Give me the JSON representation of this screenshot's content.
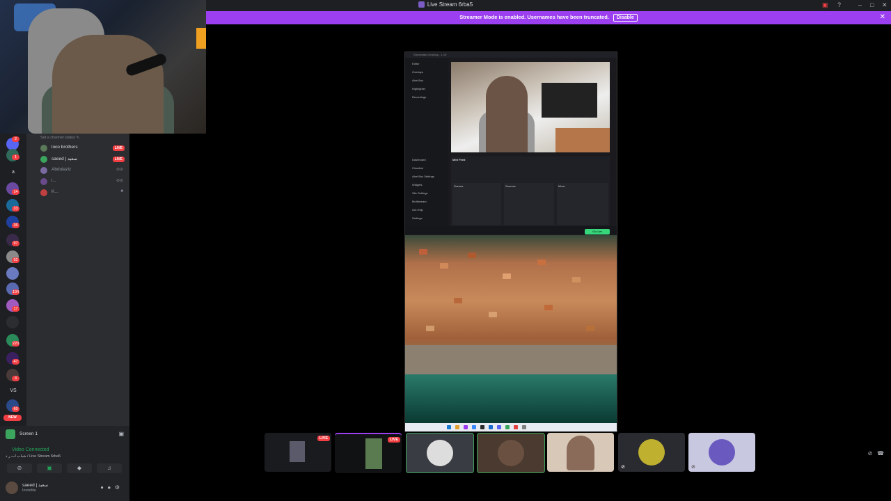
{
  "window": {
    "title": "Live Stream 6rba5",
    "controls": [
      "help-icon",
      "minimize-icon",
      "maximize-icon",
      "close-icon"
    ]
  },
  "banner": {
    "message": "Streamer Mode is enabled. Usernames have been truncated.",
    "button": "Disable"
  },
  "guilds": {
    "badges": [
      "2",
      "1",
      "14",
      "33",
      "36",
      "97",
      "92",
      "134",
      "17",
      "220",
      "47",
      "4",
      "60",
      "4"
    ],
    "texts": {
      "a": "a",
      "vs": "VS"
    },
    "new_badge": "NEW"
  },
  "channel": {
    "status_placeholder": "Set a channel status ✎",
    "voice_users": [
      {
        "name": "loco brothers",
        "live": "LIVE"
      },
      {
        "name": "saeed | سعيد",
        "live": "LIVE"
      },
      {
        "name": "Abdulaziz"
      },
      {
        "name": "i..."
      },
      {
        "name": "K..."
      }
    ]
  },
  "panel": {
    "screen_label": "Screen 1",
    "voice_status": "Video Connected",
    "voice_channel": "شباب ات ر د / Live Stream 6rba5",
    "user": {
      "name": "saeed | سعيد",
      "status": "Invisible"
    }
  },
  "stream": {
    "obs_title": "Streamlabs Desktop - 1.19",
    "obs_nav": [
      "Editor",
      "Overlays",
      "Alert Box",
      "Highlighter",
      "Recordings",
      "Dashboard",
      "Cloudbot",
      "Alert Box Settings",
      "Widgets",
      "Site Settings",
      "Multistream",
      "Get Help",
      "Settings"
    ],
    "mini_feed": "Mini Feed",
    "sections": [
      "Scenes",
      "Sources",
      "Mixer"
    ],
    "go_live": "Go Live"
  },
  "tiles": [
    {
      "live": "LIVE"
    },
    {
      "live": "LIVE"
    },
    {},
    {},
    {},
    {},
    {}
  ]
}
